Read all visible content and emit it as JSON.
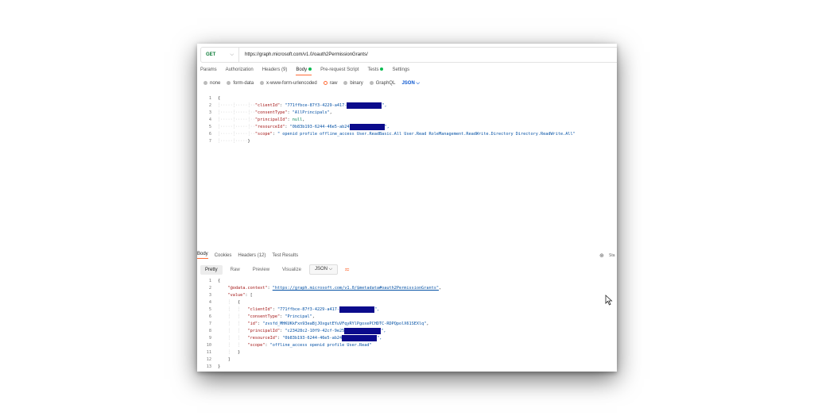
{
  "request": {
    "method": "GET",
    "url": "https://graph.microsoft.com/v1.0/oauth2PermissionGrants/"
  },
  "request_tabs": [
    {
      "label": "Params"
    },
    {
      "label": "Authorization"
    },
    {
      "label": "Headers (9)"
    },
    {
      "label": "Body"
    },
    {
      "label": "Pre-request Script"
    },
    {
      "label": "Tests"
    },
    {
      "label": "Settings"
    }
  ],
  "body_types": [
    "none",
    "form-data",
    "x-www-form-urlencoded",
    "raw",
    "binary",
    "GraphQL"
  ],
  "body_format": "JSON",
  "request_body": {
    "open": "{",
    "client_key": "\"clientId\"",
    "client_value": "\"771ffbce-87f3-4229-a417-",
    "consent_key": "\"consentType\"",
    "consent_value": "\"AllPrincipals\"",
    "principal_key": "\"principalId\"",
    "principal_value": "null",
    "resource_key": "\"resourceId\"",
    "resource_value": "\"0b83b193-6244-46e5-ab24",
    "scope_key": "\"scope\"",
    "scope_value": "\" openid profile offline_access User.ReadBasic.All User.Read RoleManagement.ReadWrite.Directory Directory.ReadWrite.All\"",
    "close": "}"
  },
  "response_tabs": [
    {
      "label": "Body"
    },
    {
      "label": "Cookies"
    },
    {
      "label": "Headers (12)"
    },
    {
      "label": "Test Results"
    }
  ],
  "response_side_text": "Sta",
  "response_views": [
    {
      "label": "Pretty"
    },
    {
      "label": "Raw"
    },
    {
      "label": "Preview"
    },
    {
      "label": "Visualize"
    }
  ],
  "response_format": "JSON",
  "response_body": {
    "open": "{",
    "context_key": "\"@odata.context\"",
    "context_value": "\"https://graph.microsoft.com/v1.0/$metadata#oauth2PermissionGrants\"",
    "value_key": "\"value\"",
    "arr_open": "[",
    "obj_open": "{",
    "client_key": "\"clientId\"",
    "client_value": "\"771ffbce-87f3-4229-a417-",
    "consent_key": "\"consentType\"",
    "consent_value": "\"Principal\"",
    "id_key": "\"id\"",
    "id_value": "\"zvsfd_MHKUKkFxn93eaBjJOxgutEYuVFqyRYlPgoxePCHDTC-RDPQpolX61SEXlq\"",
    "principal_key": "\"principalId\"",
    "principal_value": "\"c23428c2-10f9-42cf-9e25",
    "resource_key": "\"resourceId\"",
    "resource_value": "\"0b83b193-6244-46e5-ab24",
    "scope_key": "\"scope\"",
    "scope_value": "\"offline_access openid profile User.Read\"",
    "obj_close": "}",
    "arr_close": "]",
    "close": "}"
  }
}
